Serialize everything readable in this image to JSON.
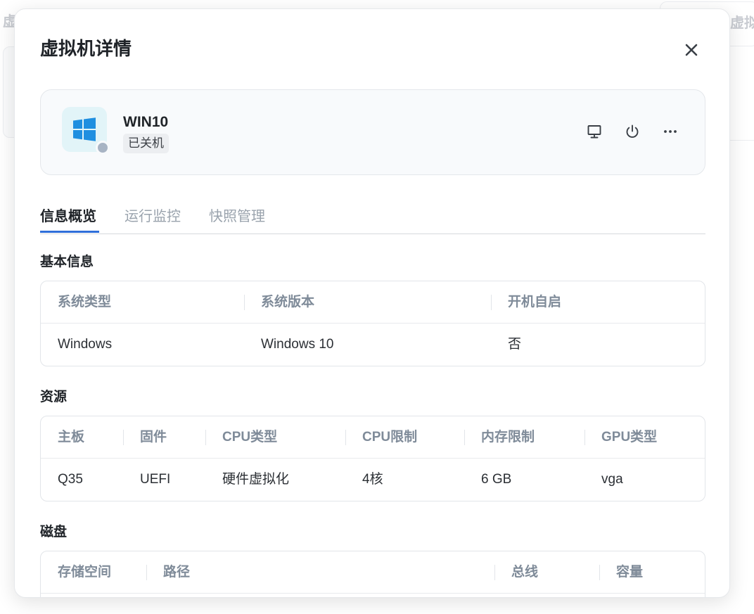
{
  "background": {
    "left_title": "虚",
    "right_title": "虚拟"
  },
  "modal": {
    "title": "虚拟机详情"
  },
  "vm": {
    "name": "WIN10",
    "state": "已关机",
    "icon": "windows-logo-icon",
    "status_color": "#a8b4c4",
    "actions": [
      "monitor-icon",
      "power-icon",
      "more-icon"
    ]
  },
  "tabs": [
    {
      "label": "信息概览",
      "active": true
    },
    {
      "label": "运行监控",
      "active": false
    },
    {
      "label": "快照管理",
      "active": false
    }
  ],
  "sections": {
    "basic": {
      "title": "基本信息",
      "headers": [
        "系统类型",
        "系统版本",
        "开机自启"
      ],
      "row": [
        "Windows",
        "Windows 10",
        "否"
      ]
    },
    "resources": {
      "title": "资源",
      "headers": [
        "主板",
        "固件",
        "CPU类型",
        "CPU限制",
        "内存限制",
        "GPU类型"
      ],
      "row": [
        "Q35",
        "UEFI",
        "硬件虚拟化",
        "4核",
        "6 GB",
        "vga"
      ]
    },
    "disks": {
      "title": "磁盘",
      "headers": [
        "存储空间",
        "路径",
        "总线",
        "容量"
      ]
    }
  },
  "colors": {
    "accent": "#2f6fda",
    "windows_blue": "#1f8fe0"
  }
}
